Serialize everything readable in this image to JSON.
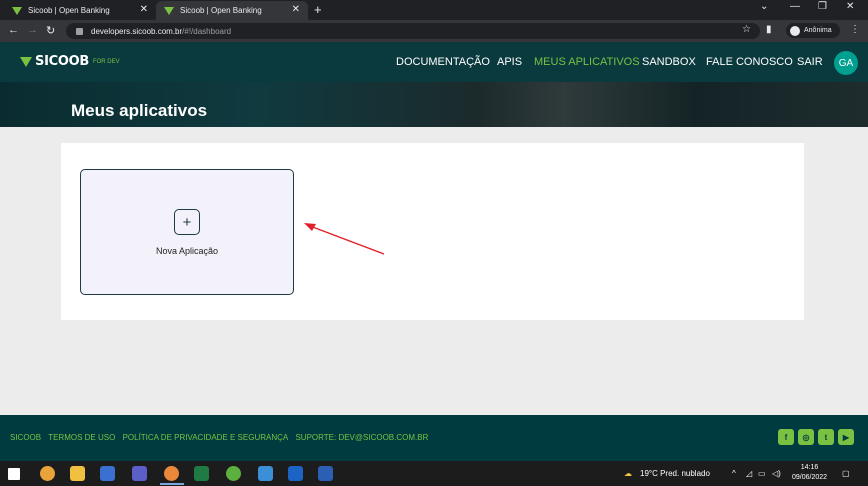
{
  "browser": {
    "tabs": [
      {
        "title": "Sicoob | Open Banking"
      },
      {
        "title": "Sicoob | Open Banking"
      }
    ],
    "new_tab_icon": "plus-icon",
    "url_host": "developers.sicoob.com.br",
    "url_path": "/#!/dashboard",
    "profile_label": "Anônima"
  },
  "app": {
    "logo_text": "SICOOB",
    "logo_sub": "FOR DEV",
    "menu": [
      {
        "label": "DOCUMENTAÇÃO"
      },
      {
        "label": "APIS"
      },
      {
        "label": "MEUS APLICATIVOS"
      },
      {
        "label": "SANDBOX"
      },
      {
        "label": "FALE CONOSCO"
      },
      {
        "label": "SAIR"
      }
    ],
    "avatar_initials": "GA",
    "page_title": "Meus aplicativos",
    "new_app_label": "Nova Aplicação",
    "accent_color": "#7ac142",
    "header_color": "#0b3a3e"
  },
  "footer": {
    "links": [
      {
        "label": "SICOOB"
      },
      {
        "label": "TERMOS DE USO"
      },
      {
        "label": "POLÍTICA DE PRIVACIDADE E SEGURANÇA"
      },
      {
        "label": "SUPORTE: DEV@SICOOB.COM.BR"
      }
    ],
    "social": [
      "facebook-icon",
      "instagram-icon",
      "twitter-icon",
      "youtube-icon"
    ]
  },
  "taskbar": {
    "weather": "19°C  Pred. nublado",
    "time": "14:16",
    "date": "09/06/2022"
  }
}
